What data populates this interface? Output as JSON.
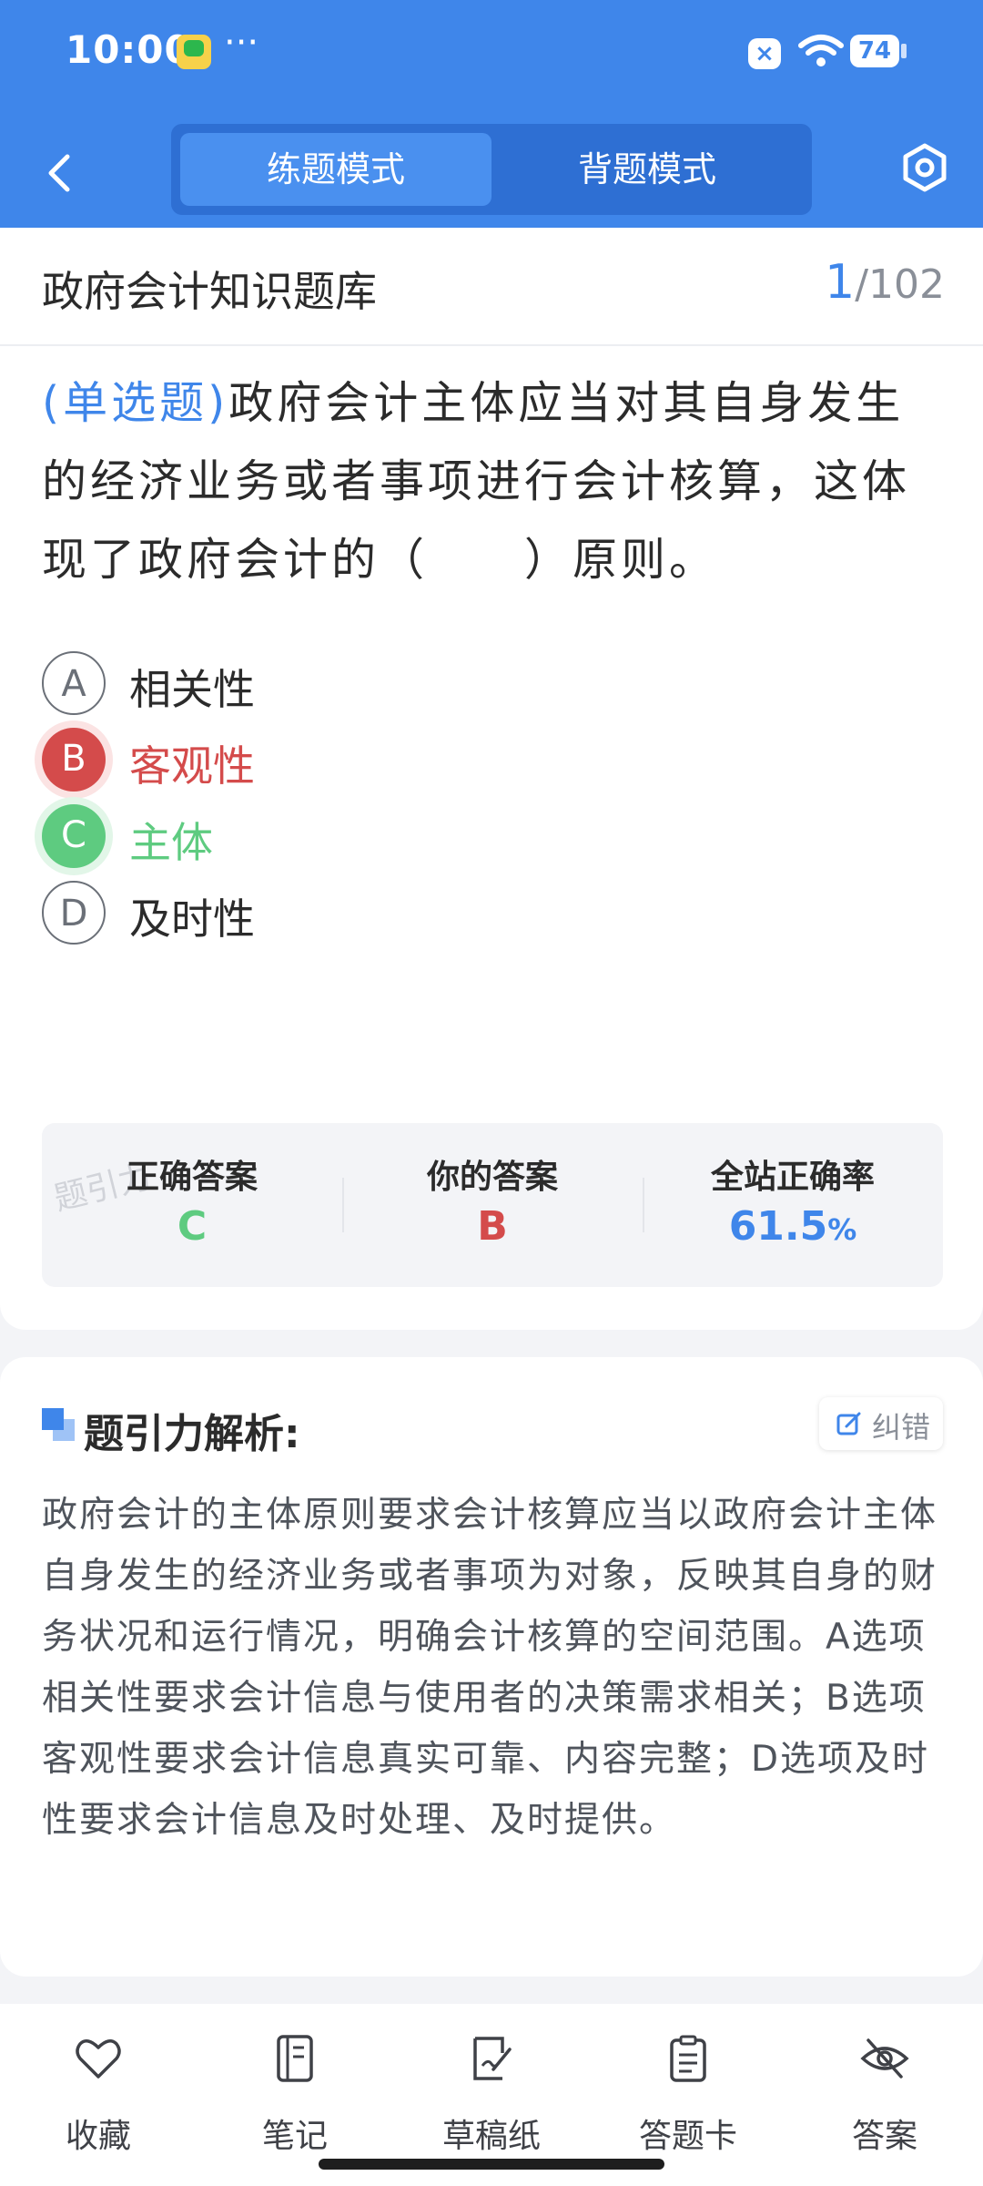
{
  "status": {
    "time": "10:00",
    "more": "···",
    "battery": "74"
  },
  "nav": {
    "tabs": [
      "练题模式",
      "背题模式"
    ],
    "active_tab": 0
  },
  "header": {
    "bank_title": "政府会计知识题库",
    "current": "1",
    "total": "/102"
  },
  "question": {
    "type": "(单选题)",
    "text": "政府会计主体应当对其自身发生的经济业务或者事项进行会计核算，这体现了政府会计的（　　）原则。"
  },
  "options": [
    {
      "letter": "A",
      "text": "相关性",
      "state": "normal"
    },
    {
      "letter": "B",
      "text": "客观性",
      "state": "wrong"
    },
    {
      "letter": "C",
      "text": "主体",
      "state": "right"
    },
    {
      "letter": "D",
      "text": "及时性",
      "state": "normal"
    }
  ],
  "answer_box": {
    "watermark": "题引力",
    "correct_label": "正确答案",
    "correct_value": "C",
    "yours_label": "你的答案",
    "yours_value": "B",
    "rate_label": "全站正确率",
    "rate_value": "61.5",
    "rate_unit": "%"
  },
  "analysis": {
    "title": "题引力解析:",
    "correct_button": "纠错",
    "text": "政府会计的主体原则要求会计核算应当以政府会计主体自身发生的经济业务或者事项为对象，反映其自身的财务状况和运行情况，明确会计核算的空间范围。A选项相关性要求会计信息与使用者的决策需求相关；B选项客观性要求会计信息真实可靠、内容完整；D选项及时性要求会计信息及时处理、及时提供。"
  },
  "toolbar": {
    "favorite": "收藏",
    "notes": "笔记",
    "draft": "草稿纸",
    "answer_card": "答题卡",
    "answer": "答案"
  },
  "colors": {
    "brand": "#3f86ea",
    "wrong": "#d44b4b",
    "right": "#5ecb80"
  },
  "icons": [
    "back-icon",
    "settings-icon",
    "edit-icon",
    "heart-icon",
    "notebook-icon",
    "draft-icon",
    "clipboard-icon",
    "eye-off-icon"
  ]
}
